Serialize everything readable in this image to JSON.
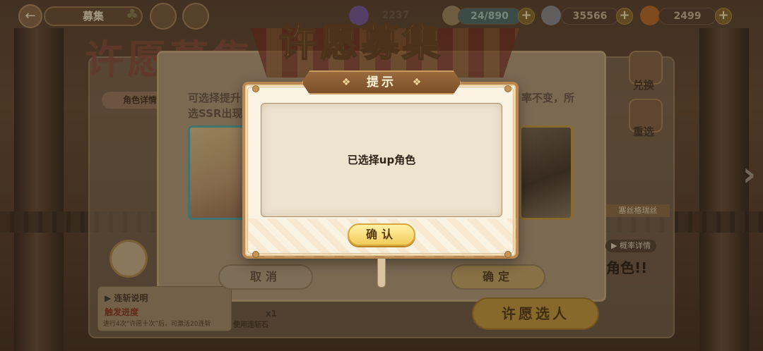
{
  "topbar": {
    "back_icon": "back-arrow-icon",
    "title": "募集",
    "res_hidden": "2237",
    "stamina": "24/890",
    "coins": "35566",
    "carrots": "2499",
    "plus": "+"
  },
  "background": {
    "page_title": "许愿募集",
    "banner_title": "许愿募集",
    "search_label": "角色详情",
    "panel_hint_left": "可选择提升",
    "panel_hint_left2": "选SSR出现",
    "panel_hint_right": "率不变，所",
    "exchange_label": "兑换",
    "reselect_label": "重选",
    "up_name": "塞丝格瑞丝",
    "prob_detail": "概率详情",
    "role_hint": "角色!!",
    "combo_title": "连斩说明",
    "combo_progress": "触发进度",
    "combo_desc": "进行4次“许愿十次”后，可激活20连斩",
    "use_stone": "使用连斩石",
    "stone_count": "x1",
    "cancel_label": "取消",
    "confirm_label": "确定",
    "wish_label": "许愿选人"
  },
  "dialog": {
    "title": "提示",
    "message": "已选择up角色",
    "ok_label": "确认"
  },
  "colors": {
    "dialog_border": "#b9874f",
    "dialog_bg": "#fbf3e1",
    "header_bg": "#8a5c32",
    "ok_button": "#f3cc58"
  }
}
